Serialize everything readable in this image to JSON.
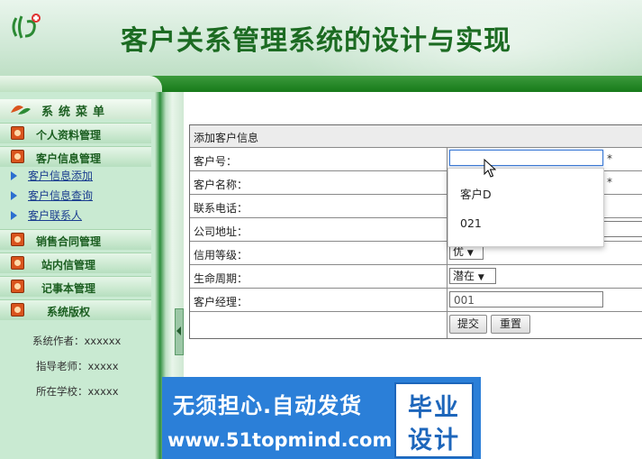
{
  "header": {
    "title": "客户关系管理系统的设计与实现"
  },
  "sidebar": {
    "heading": "系统菜单",
    "menus": [
      {
        "label": "个人资料管理"
      },
      {
        "label": "客户信息管理"
      },
      {
        "label": "销售合同管理"
      },
      {
        "label": "站内信管理"
      },
      {
        "label": "记事本管理"
      },
      {
        "label": "系统版权"
      }
    ],
    "submenus": [
      {
        "label": "客户信息添加"
      },
      {
        "label": "客户信息查询"
      },
      {
        "label": "客户联系人"
      }
    ],
    "info": [
      "系统作者：xxxxxx",
      "指导老师：xxxxx",
      "所在学校：xxxxx"
    ]
  },
  "form": {
    "heading": "添加客户信息",
    "fields": {
      "customer_no": {
        "label": "客户号：",
        "value": "",
        "required": "*"
      },
      "customer_name": {
        "label": "客户名称：",
        "required": "*"
      },
      "phone": {
        "label": "联系电话："
      },
      "address": {
        "label": "公司地址："
      },
      "credit": {
        "label": "信用等级：",
        "selected": "优"
      },
      "lifecycle": {
        "label": "生命周期：",
        "selected": "潜在"
      },
      "manager": {
        "label": "客户经理：",
        "value": "001"
      }
    },
    "submit_label": "提交",
    "reset_label": "重置"
  },
  "autocomplete": {
    "options": [
      "客户D",
      "021"
    ]
  },
  "watermark": {
    "line1": "无须担心.自动发货",
    "line2": "www.51topmind.com",
    "badge_top": "毕业",
    "badge_bottom": "设计"
  }
}
